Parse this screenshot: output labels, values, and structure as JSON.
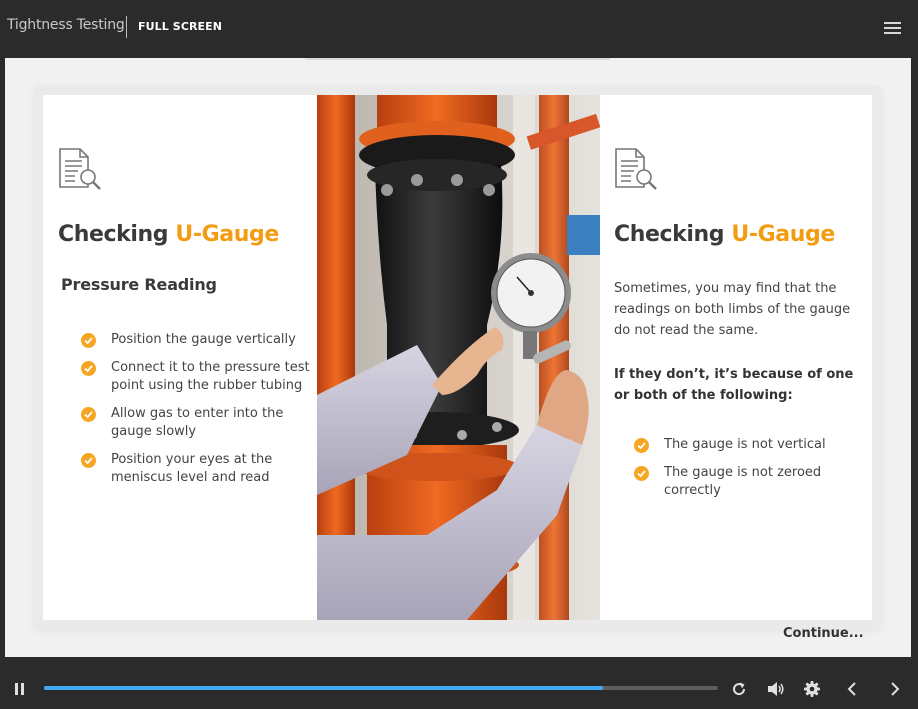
{
  "header": {
    "app_title": "Tightness Testing",
    "fullscreen_label": "FULL SCREEN",
    "menu_icon": "hamburger-menu-icon"
  },
  "slide": {
    "left": {
      "icon": "document-search-icon",
      "heading_plain": "Checking ",
      "heading_accent": "U-Gauge",
      "subheading": "Pressure Reading",
      "bullets": [
        "Position the gauge vertically",
        "Connect it to the pressure test point using the rubber tubing",
        "Allow gas to enter into the gauge slowly",
        "Position your eyes at the meniscus level and read"
      ]
    },
    "photo": {
      "description_icon": "gauge-photo"
    },
    "right": {
      "icon": "document-search-icon",
      "heading_plain": "Checking ",
      "heading_accent": "U-Gauge",
      "paragraph": "Sometimes, you may find that the readings on both limbs of the gauge do not read the same.",
      "bold_paragraph": "If they don’t, it’s because of one or both of the following:",
      "bullets": [
        "The gauge is not vertical",
        "The gauge is not zeroed correctly"
      ]
    },
    "continue_label": "Continue..."
  },
  "controls": {
    "progress": 0.83,
    "icons": [
      "pause-icon",
      "replay-icon",
      "volume-icon",
      "settings-icon",
      "previous-icon",
      "next-icon"
    ]
  },
  "colors": {
    "accent": "#f39c12",
    "check": "#f5a623",
    "progress": "#3fa9f5",
    "bar": "#2b2b2b"
  }
}
